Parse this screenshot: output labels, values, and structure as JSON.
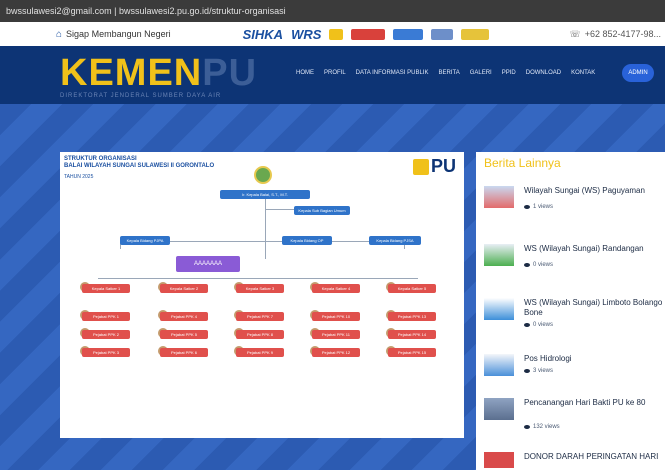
{
  "browser": {
    "url": "bwssulawesi2@gmail.com | bwssulawesi2.pu.go.id/struktur-organisasi"
  },
  "topbar": {
    "tagline": "Sigap Membangun Negeri",
    "logos": [
      "SIHKA",
      "WRS"
    ],
    "phone": "+62 852-4177-98..."
  },
  "header": {
    "brand_main": "KEMEN",
    "brand_pu": "PU",
    "brand_sub": "DIREKTORAT JENDERAL SUMBER DAYA AIR",
    "menu": [
      "HOME",
      "PROFIL",
      "DATA INFORMASI PUBLIK",
      "BERITA",
      "GALERI",
      "PPID",
      "DOWNLOAD",
      "KONTAK"
    ],
    "admin_label": "ADMIN"
  },
  "org_chart": {
    "title_line1": "STRUKTUR ORGANISASI",
    "title_line2": "BALAI WILAYAH SUNGAI SULAWESI II GORONTALO",
    "year": "TAHUN 2025",
    "logo_text": "PU",
    "head_name": "Ir. Kepala Balai, S.T., M.T.",
    "secretary_name": "Kepala Sub Bagian Umum",
    "level2": [
      "Kepala Bidang PJPA",
      "Kepala Bidang OP",
      "Kepala Bidang PJSA"
    ],
    "purple_label": "AAAAAAA",
    "columns": [
      [
        "Kepala Satker 1",
        "Pejabat PPK 1",
        "Pejabat PPK 2",
        "Pejabat PPK 3"
      ],
      [
        "Kepala Satker 2",
        "Pejabat PPK 4",
        "Pejabat PPK 5",
        "Pejabat PPK 6"
      ],
      [
        "Kepala Satker 3",
        "Pejabat PPK 7",
        "Pejabat PPK 8",
        "Pejabat PPK 9"
      ],
      [
        "Kepala Satker 4",
        "Pejabat PPK 10",
        "Pejabat PPK 11",
        "Pejabat PPK 12"
      ],
      [
        "Kepala Satker 5",
        "Pejabat PPK 13",
        "Pejabat PPK 14",
        "Pejabat PPK 15"
      ]
    ]
  },
  "sidebar": {
    "title": "Berita Lainnya",
    "items": [
      {
        "title": "Wilayah Sungai (WS) Paguyaman",
        "views": "1 views"
      },
      {
        "title": "WS (Wilayah Sungai) Randangan",
        "views": "0 views"
      },
      {
        "title": "WS (Wilayah Sungai) Limboto Bolango Bone",
        "views": "0 views"
      },
      {
        "title": "Pos Hidrologi",
        "views": "3 views"
      },
      {
        "title": "Pencanangan Hari Bakti PU ke 80",
        "views": "132 views"
      },
      {
        "title": "DONOR DARAH PERINGATAN HARI",
        "views": ""
      }
    ]
  },
  "colors": {
    "brand_yellow": "#f0c11a",
    "nav_blue": "#0d3475",
    "accent_blue": "#2962d9",
    "box_red": "#e0504c"
  }
}
